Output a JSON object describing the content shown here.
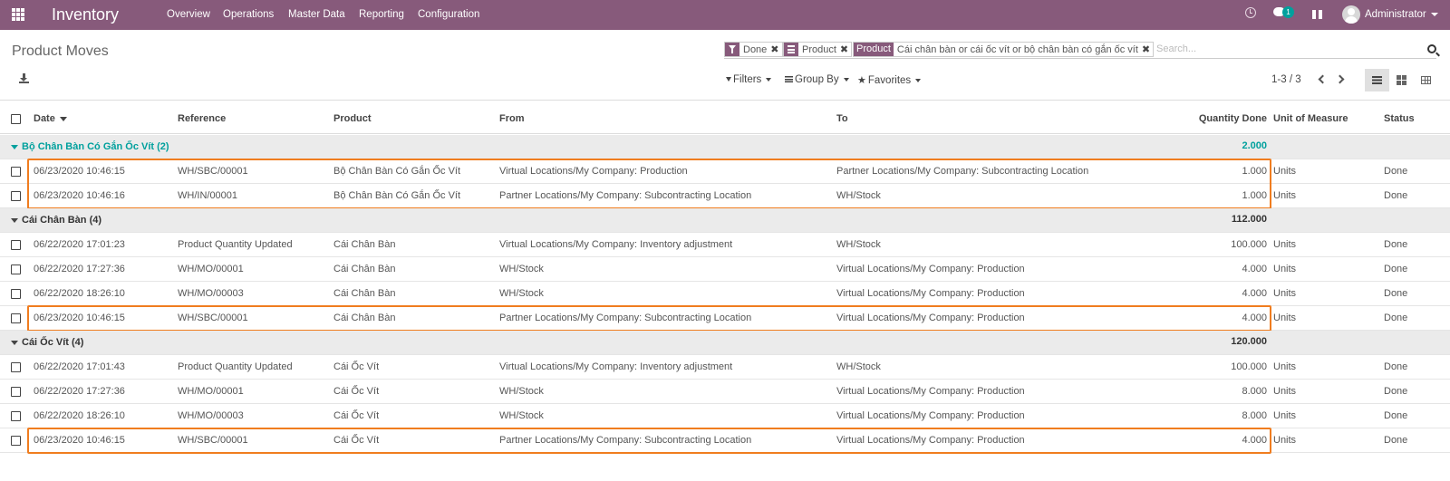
{
  "navbar": {
    "app_name": "Inventory",
    "menu": [
      "Overview",
      "Operations",
      "Master Data",
      "Reporting",
      "Configuration"
    ],
    "chat_badge": "1",
    "user": "Administrator",
    "icons": [
      "apps-grid-icon",
      "clock-icon",
      "chat-icon",
      "gift-icon",
      "avatar"
    ],
    "bg_color": "#875a7b"
  },
  "page": {
    "title": "Product Moves"
  },
  "search": {
    "facets": [
      {
        "icon": "filter-icon",
        "text": "Done"
      },
      {
        "icon": "group-by-icon",
        "text": "Product"
      },
      {
        "label": "Product",
        "text": "Cái chân bàn or cái ốc vít or bộ chân bàn có gắn ốc vít"
      }
    ],
    "placeholder": "Search..."
  },
  "controls": {
    "filters": "Filters",
    "group_by": "Group By",
    "favorites": "Favorites",
    "pager": "1-3 / 3"
  },
  "table": {
    "columns": [
      "Date",
      "Reference",
      "Product",
      "From",
      "To",
      "Quantity Done",
      "Unit of Measure",
      "Status"
    ],
    "groups": [
      {
        "name": "Bộ Chân Bàn Có Gắn Ốc Vít (2)",
        "total": "2.000",
        "rows": [
          [
            "06/23/2020 10:46:15",
            "WH/SBC/00001",
            "Bộ Chân Bàn Có Gắn Ốc Vít",
            "Virtual Locations/My Company: Production",
            "Partner Locations/My Company: Subcontracting Location",
            "1.000",
            "Units",
            "Done"
          ],
          [
            "06/23/2020 10:46:16",
            "WH/IN/00001",
            "Bộ Chân Bàn Có Gắn Ốc Vít",
            "Partner Locations/My Company: Subcontracting Location",
            "WH/Stock",
            "1.000",
            "Units",
            "Done"
          ]
        ]
      },
      {
        "name": "Cái Chân Bàn (4)",
        "total": "112.000",
        "rows": [
          [
            "06/22/2020 17:01:23",
            "Product Quantity Updated",
            "Cái Chân Bàn",
            "Virtual Locations/My Company: Inventory adjustment",
            "WH/Stock",
            "100.000",
            "Units",
            "Done"
          ],
          [
            "06/22/2020 17:27:36",
            "WH/MO/00001",
            "Cái Chân Bàn",
            "WH/Stock",
            "Virtual Locations/My Company: Production",
            "4.000",
            "Units",
            "Done"
          ],
          [
            "06/22/2020 18:26:10",
            "WH/MO/00003",
            "Cái Chân Bàn",
            "WH/Stock",
            "Virtual Locations/My Company: Production",
            "4.000",
            "Units",
            "Done"
          ],
          [
            "06/23/2020 10:46:15",
            "WH/SBC/00001",
            "Cái Chân Bàn",
            "Partner Locations/My Company: Subcontracting Location",
            "Virtual Locations/My Company: Production",
            "4.000",
            "Units",
            "Done"
          ]
        ]
      },
      {
        "name": "Cái Ốc Vít (4)",
        "total": "120.000",
        "rows": [
          [
            "06/22/2020 17:01:43",
            "Product Quantity Updated",
            "Cái Ốc Vít",
            "Virtual Locations/My Company: Inventory adjustment",
            "WH/Stock",
            "100.000",
            "Units",
            "Done"
          ],
          [
            "06/22/2020 17:27:36",
            "WH/MO/00001",
            "Cái Ốc Vít",
            "WH/Stock",
            "Virtual Locations/My Company: Production",
            "8.000",
            "Units",
            "Done"
          ],
          [
            "06/22/2020 18:26:10",
            "WH/MO/00003",
            "Cái Ốc Vít",
            "WH/Stock",
            "Virtual Locations/My Company: Production",
            "8.000",
            "Units",
            "Done"
          ],
          [
            "06/23/2020 10:46:15",
            "WH/SBC/00001",
            "Cái Ốc Vít",
            "Partner Locations/My Company: Subcontracting Location",
            "Virtual Locations/My Company: Production",
            "4.000",
            "Units",
            "Done"
          ]
        ]
      }
    ]
  },
  "colors": {
    "brand": "#875a7b",
    "group_accent": "#00a09d",
    "highlight_border": "#f07d1f"
  }
}
